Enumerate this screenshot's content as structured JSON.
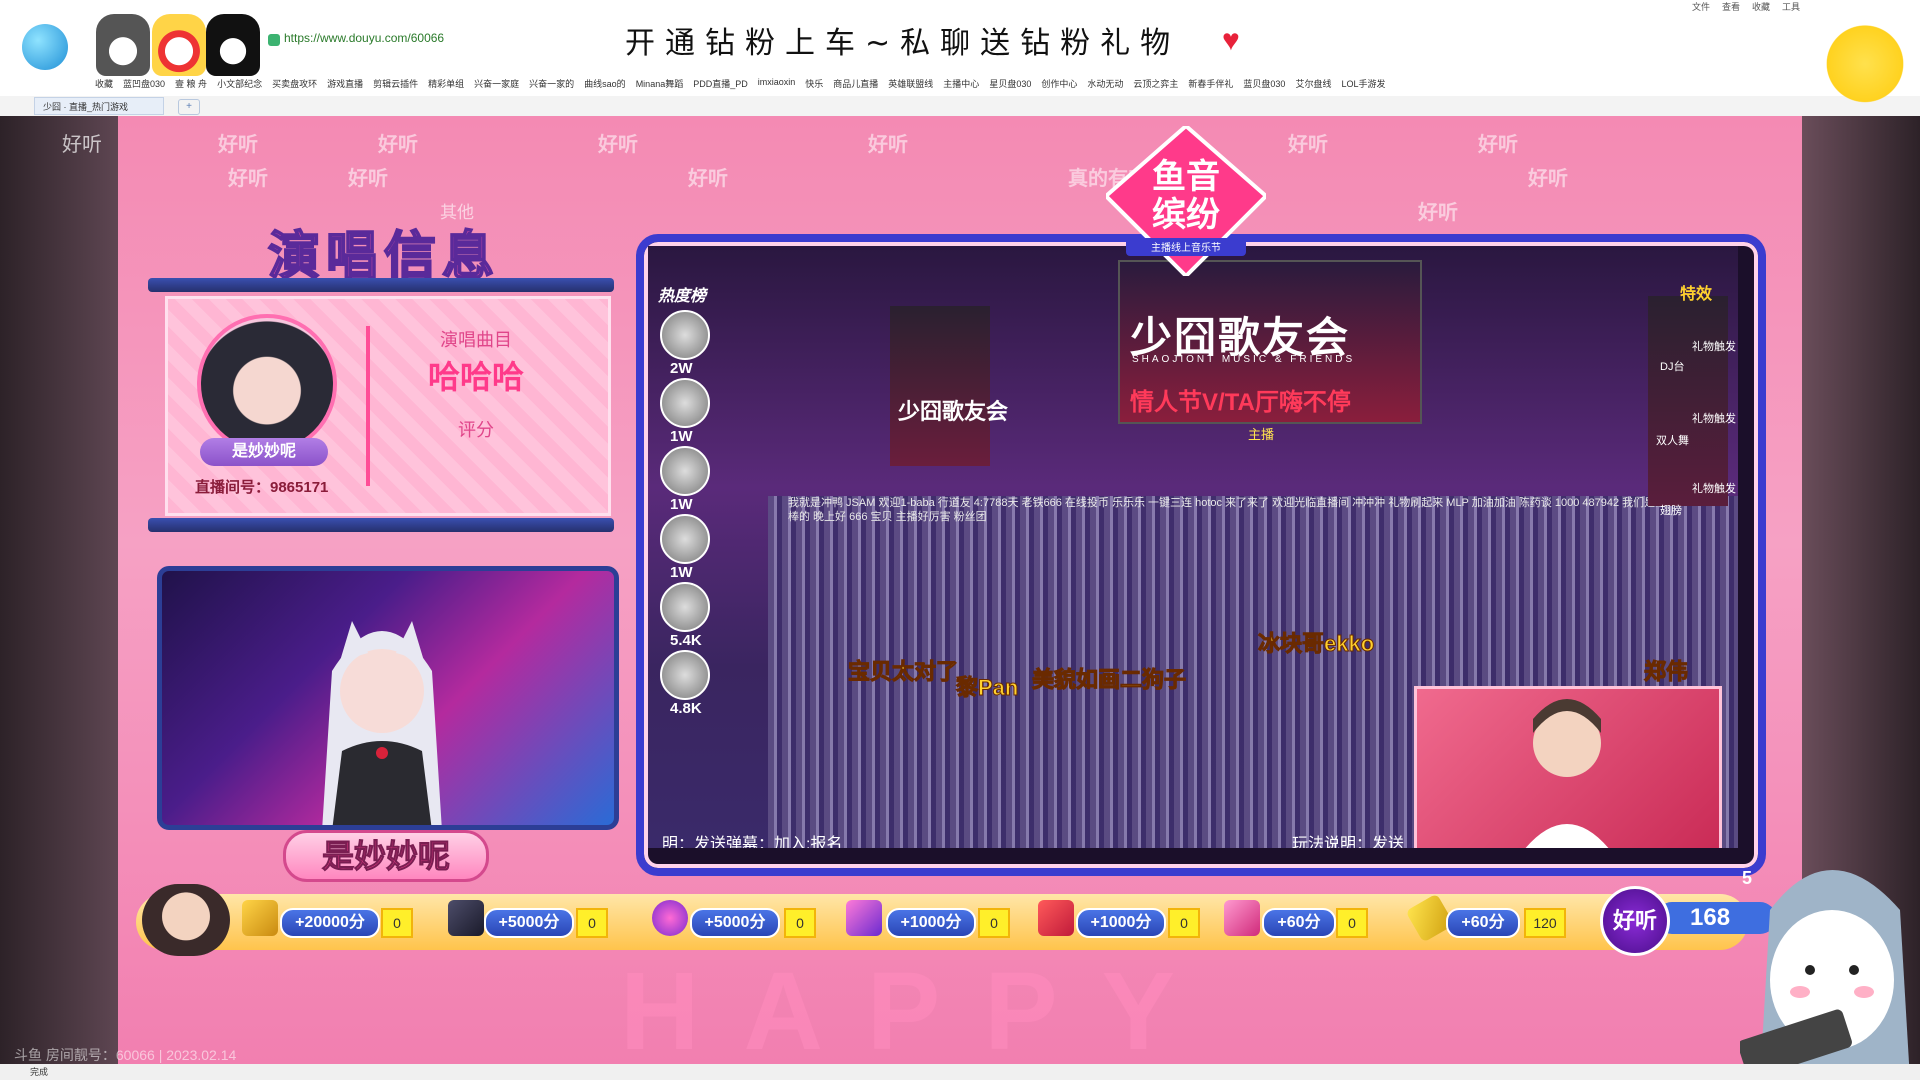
{
  "browser": {
    "url": "https://www.douyu.com/60066",
    "promo": "开通钻粉上车~私聊送钻粉礼物",
    "menu": [
      "文件",
      "查看",
      "收藏",
      "工具"
    ],
    "bookmarks": [
      "收藏",
      "蓝凹盘030",
      "壹 粮 舟",
      "小文部纪念",
      "买卖盘攻环",
      "游戏直播",
      "剪辑云插件",
      "精彩单组",
      "兴奋一家庭",
      "兴奋一家的",
      "曲线sao的",
      "Minana舞蹈",
      "PDD直播_PD",
      "imxiaoxin",
      "快乐",
      "商品儿直播",
      "英雄联盟线",
      "主播中心",
      "星贝盘030",
      "创作中心",
      "水动无动",
      "云顶之弈主",
      "新春手伴礼",
      "蓝贝盘030",
      "艾尔盘线",
      "LOL手游发"
    ],
    "tab_label": "少囧 · 直播_热门游戏",
    "status": "完成"
  },
  "overlay": {
    "watermark": "好听",
    "watermark_extra": "其他",
    "watermark_extra2": "真的有实力",
    "info_title": "演唱信息",
    "anchor_name": "是妙妙呢",
    "room_label": "直播间号：9865171",
    "song_label": "演唱曲目",
    "song_title": "哈哈哈",
    "score_label": "评分",
    "anchor_banner": "是妙妙呢",
    "happy_text": "HAPPY",
    "footer": "斗鱼 房间靓号：60066 | 2023.02.14"
  },
  "concert": {
    "hot_title": "热度榜",
    "hot_counts": [
      "2W",
      "1W",
      "1W",
      "1W",
      "5.4K",
      "4.8K"
    ],
    "effects_title": "特效",
    "effect_labels": [
      "礼物触发",
      "DJ台",
      "礼物触发",
      "双人舞",
      "礼物触发",
      "翅膀"
    ],
    "stage_title": "少囧歌友会",
    "stage_sub": "SHAOJIONT MUSIC & FRIENDS",
    "stage_red": "情人节V/TA厅嗨不停",
    "host_label": "主播",
    "left_screen_title": "少囧歌友会",
    "user_labels": [
      "宝贝太对了",
      "黎Pan",
      "美貌如画二狗子",
      "冰块哥ekko",
      "郑伟"
    ],
    "danmu": "我就是冲鸭 JSAM 欢迎1-baba 行道友 4:7788天 老铁666 在线投币 乐乐乐 一键三连 hotoc 来了来了 欢迎光临直播间 冲冲冲 礼物刷起来 MLP 加油加油 陈药谈 1000 487942 我们是最棒的 晚上好 666 宝贝 主播好厉害 粉丝团",
    "ticker_left": "明：发送弹幕：加入:报名",
    "ticker_right": "玩法说明：发送",
    "logo_line1": "鱼音",
    "logo_line2": "缤纷",
    "logo_sub": "主播线上音乐节"
  },
  "score_bar": {
    "items": [
      {
        "label": "+20000分",
        "count": "0"
      },
      {
        "label": "+5000分",
        "count": "0"
      },
      {
        "label": "+5000分",
        "count": "0"
      },
      {
        "label": "+1000分",
        "count": "0"
      },
      {
        "label": "+1000分",
        "count": "0"
      },
      {
        "label": "+60分",
        "count": "0"
      },
      {
        "label": "+60分",
        "count": "120"
      }
    ],
    "total_badge": "好听",
    "total_value": "168",
    "right_num": "5"
  },
  "colors": {
    "accent_pink": "#ff3a8a",
    "navy": "#2c3e96",
    "gold": "#ffd12e"
  }
}
